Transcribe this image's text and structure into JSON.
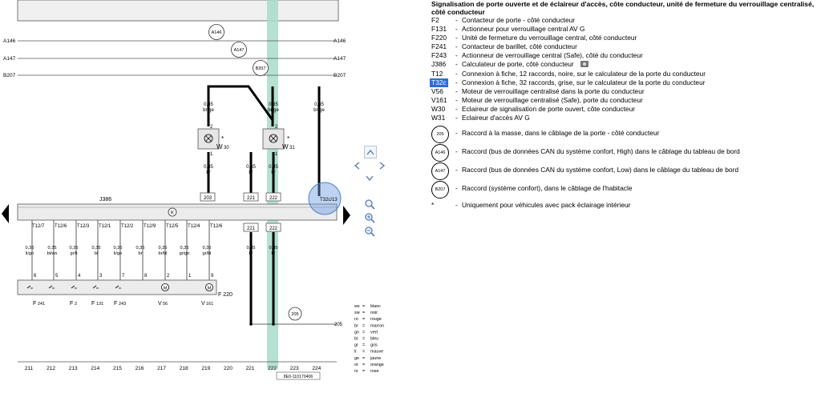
{
  "diagram": {
    "header_labels": {
      "a146": "A146",
      "a147": "A147",
      "b207": "B207"
    },
    "top_bubbles": [
      "A146",
      "A147",
      "B207"
    ],
    "wire_top": [
      {
        "gauge": "0,35",
        "color": "br/ge"
      },
      {
        "gauge": "0,35",
        "color": "br/ge"
      },
      {
        "gauge": "0,35",
        "color": "br/ge"
      }
    ],
    "lamps": [
      {
        "pin_top": "2",
        "pin_bottom": "1",
        "star": "*",
        "label": "W",
        "sub": "30"
      },
      {
        "pin_top": "2",
        "pin_bottom": "1",
        "star": "*",
        "label": "W",
        "sub": "31"
      }
    ],
    "wire_mid": [
      {
        "gauge": "0,35",
        "color": "br"
      },
      {
        "gauge": "0,35",
        "color": "br"
      },
      {
        "gauge": "0,35",
        "color": "br"
      }
    ],
    "mid_boxes": [
      "203",
      "221",
      "222"
    ],
    "ecu_label": "J386",
    "connector_label": "T32c/13",
    "t12_pins": [
      "T12/7",
      "T12/6",
      "T12/3",
      "T12/1",
      "T12/2",
      "T12/9",
      "T12/5",
      "T12/4",
      "T12/6"
    ],
    "lower_boxes": [
      "221",
      "222"
    ],
    "wire_low": [
      {
        "gauge": "0,35",
        "color": "li/gn"
      },
      {
        "gauge": "0,35",
        "color": "bl/ws"
      },
      {
        "gauge": "0,35",
        "color": "gr/li"
      },
      {
        "gauge": "0,35",
        "color": "bl"
      },
      {
        "gauge": "0,35",
        "color": "li/ge"
      },
      {
        "gauge": "0,35",
        "color": "br"
      },
      {
        "gauge": "0,35",
        "color": "br/bl"
      },
      {
        "gauge": "0,35",
        "color": "gr/gn"
      },
      {
        "gauge": "0,35",
        "color": "gr/bl"
      },
      {
        "gauge": "0,35",
        "color": "br"
      },
      {
        "gauge": "0,35",
        "color": "br"
      }
    ],
    "component_pins": [
      "6",
      "5",
      "4",
      "3",
      "7",
      "8",
      "2",
      "1",
      "9"
    ],
    "f220": "F 220",
    "bottom_components": [
      {
        "label": "F",
        "sub": "241"
      },
      {
        "label": "F",
        "sub": "2"
      },
      {
        "label": "F",
        "sub": "131"
      },
      {
        "label": "F",
        "sub": "243"
      },
      {
        "label": "V",
        "sub": "56"
      },
      {
        "label": "V",
        "sub": "161"
      }
    ],
    "ground_bubble": "205",
    "ground_label": "205",
    "column_numbers": [
      "211",
      "212",
      "213",
      "214",
      "215",
      "216",
      "217",
      "218",
      "219",
      "220",
      "221",
      "222",
      "223",
      "224"
    ],
    "ref_code": "8E0-110170406",
    "color_codes": [
      {
        "code": "ws",
        "eq": "=",
        "name": "blanc"
      },
      {
        "code": "sw",
        "eq": "=",
        "name": "noir"
      },
      {
        "code": "ro",
        "eq": "=",
        "name": "rouge"
      },
      {
        "code": "br",
        "eq": "=",
        "name": "marron"
      },
      {
        "code": "gn",
        "eq": "=",
        "name": "vert"
      },
      {
        "code": "bl",
        "eq": "=",
        "name": "bleu"
      },
      {
        "code": "gr",
        "eq": "=",
        "name": "gris"
      },
      {
        "code": "li",
        "eq": "=",
        "name": "mauve"
      },
      {
        "code": "ge",
        "eq": "=",
        "name": "jaune"
      },
      {
        "code": "or",
        "eq": "=",
        "name": "orange"
      },
      {
        "code": "rs",
        "eq": "=",
        "name": "rose"
      }
    ]
  },
  "legend": {
    "title_lines": [
      "Signalisation de porte ouverte et de éclaireur d'accès, côte conducteur, unité de fermeture du verrouillage centralisé,",
      "côté conducteur"
    ],
    "entries": [
      {
        "code": "F2",
        "desc": "Contacteur de porte - côté conducteur"
      },
      {
        "code": "F131",
        "desc": "Actionneur pour verrouillage central AV G"
      },
      {
        "code": "F220",
        "desc": "Unité de fermeture du verrouillage central, côté conducteur"
      },
      {
        "code": "F241",
        "desc": "Contacteur de barillet, côté conducteur"
      },
      {
        "code": "F243",
        "desc": "Actionneur de verrouillage central (Safe), côté du conducteur"
      },
      {
        "code": "J386",
        "desc": "Calculateur de porte, côté conducteur"
      },
      {
        "code": "T12",
        "desc": "Connexion à fiche, 12 raccords, noire, sur le calculateur de la porte du conducteur"
      },
      {
        "code": "T32c",
        "desc": "Connexion à fiche, 32 raccords, grise, sur le calculateur de la porte du conducteur"
      },
      {
        "code": "V56",
        "desc": "Moteur de verrouillage centralisé dans la porte du conducteur"
      },
      {
        "code": "V161",
        "desc": "Moteur de verrouillage centralisé (Safe), porte du conducteur"
      },
      {
        "code": "W30",
        "desc": "Eclaireur de signalisation de porte ouvert, côte conducteur"
      },
      {
        "code": "W31",
        "desc": "Eclaireur d'accès AV G"
      }
    ],
    "circle_entries": [
      {
        "code": "205",
        "desc": "Raccord à la masse, dans le câblage de la porte - côté conducteur"
      },
      {
        "code": "A146",
        "desc": "Raccord (bus de données CAN du système confort, High) dans le câblage du tableau de bord"
      },
      {
        "code": "A147",
        "desc": "Raccord (bus de données CAN du système confort, Low) dans le câblage du tableau de bord"
      },
      {
        "code": "B207",
        "desc": "Raccord (système confort), dans le câblage de l'habitacle"
      }
    ],
    "footnote": {
      "code": "*",
      "desc": "Uniquement pour véhicules avec pack éclairage intérieur"
    }
  },
  "colors": {
    "highlight_band": "#a8dcc8",
    "connector_circle": "#6f9be0",
    "selection": "#2f6bd6"
  },
  "icons": [
    "camera-icon",
    "nav-up-icon",
    "nav-left-icon",
    "nav-right-icon",
    "nav-down-icon",
    "zoom-in-icon",
    "zoom-out-icon",
    "fit-icon"
  ]
}
